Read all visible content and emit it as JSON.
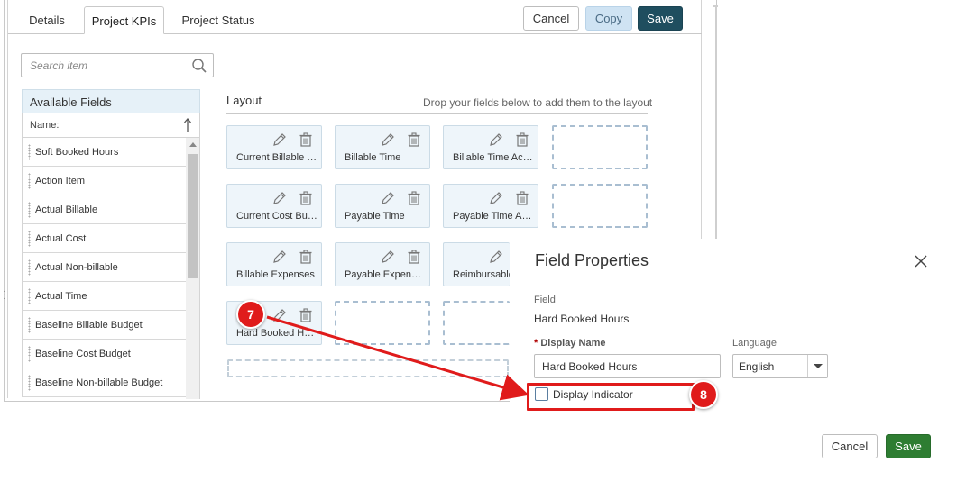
{
  "tabs": [
    {
      "label": "Details"
    },
    {
      "label": "Project KPIs"
    },
    {
      "label": "Project Status"
    }
  ],
  "toolbar": {
    "cancel": "Cancel",
    "copy": "Copy",
    "save": "Save"
  },
  "search": {
    "placeholder": "Search item"
  },
  "available_fields": {
    "header": "Available Fields",
    "column": "Name:",
    "items": [
      "Soft Booked Hours",
      "Action Item",
      "Actual Billable",
      "Actual Cost",
      "Actual Non-billable",
      "Actual Time",
      "Baseline Billable Budget",
      "Baseline Cost Budget",
      "Baseline Non-billable Budget"
    ]
  },
  "layout": {
    "title": "Layout",
    "hint": "Drop your fields below to add them to the layout",
    "cards": [
      "Current Billable Time",
      "Billable Time",
      "Billable Time Actual",
      "Current Cost Budget",
      "Payable Time",
      "Payable Time Actual",
      "Billable Expenses",
      "Payable Expenses",
      "Reimbursable",
      "Hard Booked Hours"
    ]
  },
  "panel": {
    "title": "Field Properties",
    "field_label": "Field",
    "field_value": "Hard Booked Hours",
    "required_mark": "*",
    "display_name_label": "Display Name",
    "display_name_value": "Hard Booked Hours",
    "language_label": "Language",
    "language_value": "English",
    "display_indicator": "Display Indicator",
    "display_indicator_checked": false,
    "cancel": "Cancel",
    "save": "Save"
  },
  "annotations": {
    "step7": "7",
    "step8": "8",
    "color": "#e01b1b"
  },
  "colors": {
    "save_dark": "#1f4e5f",
    "save_green": "#2e7d32",
    "copy": "#cfe3f3",
    "card_bg": "#eef5fa"
  }
}
